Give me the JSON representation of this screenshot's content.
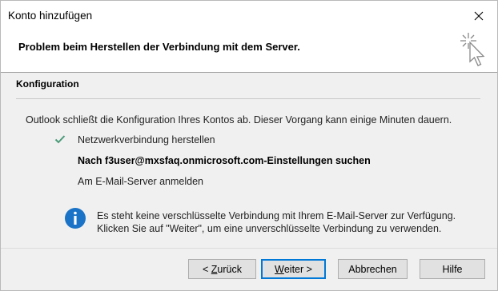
{
  "window": {
    "title": "Konto hinzufügen"
  },
  "header": {
    "title": "Problem beim Herstellen der Verbindung mit dem Server."
  },
  "section": {
    "title": "Konfiguration",
    "description": "Outlook schließt die Konfiguration Ihres Kontos ab. Dieser Vorgang kann einige Minuten dauern."
  },
  "steps": [
    {
      "label": "Netzwerkverbindung herstellen",
      "status": "done",
      "icon": "check-icon",
      "color": "#4a9a78"
    },
    {
      "label": "Nach f3user@mxsfaq.onmicrosoft.com-Einstellungen suchen",
      "status": "current"
    },
    {
      "label": "Am E-Mail-Server anmelden",
      "status": "pending"
    }
  ],
  "notice": {
    "icon": "info-icon",
    "icon_color": "#1a73c7",
    "line1": "Es steht keine verschlüsselte Verbindung mit Ihrem E-Mail-Server zur Verfügung.",
    "line2": "Klicken Sie auf \"Weiter\", um eine unverschlüsselte Verbindung zu verwenden."
  },
  "buttons": {
    "back_prefix": "< ",
    "back_mnemonic": "Z",
    "back_rest": "urück",
    "next_mnemonic": "W",
    "next_rest": "eiter >",
    "cancel": "Abbrechen",
    "help": "Hilfe"
  },
  "colors": {
    "accent": "#0078d7"
  }
}
